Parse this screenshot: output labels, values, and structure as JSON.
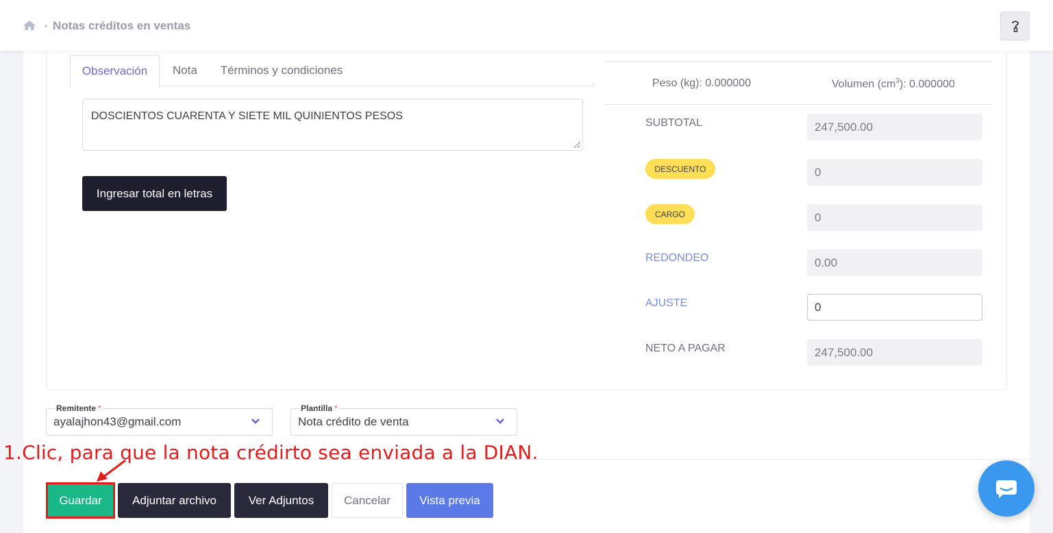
{
  "breadcrumb": {
    "home_icon": "home-icon",
    "title": "Notas créditos en ventas"
  },
  "header": {
    "help_icon": "question-key-icon"
  },
  "tabs": [
    {
      "label": "Observación",
      "active": true
    },
    {
      "label": "Nota",
      "active": false
    },
    {
      "label": "Términos y condiciones",
      "active": false
    }
  ],
  "observacion": {
    "text": "DOSCIENTOS CUARENTA Y SIETE MIL QUINIENTOS  PESOS",
    "button_label": "Ingresar total en letras"
  },
  "measures": {
    "peso": "Peso (kg): 0.000000",
    "volumen_prefix": "Volumen (cm",
    "volumen_sup": "3",
    "volumen_suffix": "): 0.000000"
  },
  "summary": {
    "subtotal": {
      "label": "SUBTOTAL",
      "value": "247,500.00"
    },
    "descuento": {
      "label": "DESCUENTO",
      "value": "0"
    },
    "cargo": {
      "label": "CARGO",
      "value": "0"
    },
    "redondeo": {
      "label": "REDONDEO",
      "value": "0.00"
    },
    "ajuste": {
      "label": "AJUSTE",
      "value": "0"
    },
    "neto": {
      "label": "NETO A PAGAR",
      "value": "247,500.00"
    }
  },
  "remitente": {
    "label": "Remitente",
    "required_mark": "*",
    "value": "ayalajhon43@gmail.com"
  },
  "plantilla": {
    "label": "Plantilla",
    "required_mark": "*",
    "value": "Nota crédito de venta"
  },
  "annotation": "1.Clic, para que la nota crédirto sea enviada a la DIAN.",
  "actions": {
    "save": "Guardar",
    "attach": "Adjuntar archivo",
    "view_attachments": "Ver Adjuntos",
    "cancel": "Cancelar",
    "preview": "Vista previa"
  },
  "colors": {
    "accent_tab": "#716aca",
    "badge_yellow": "#ffde57",
    "save_green": "#1ab789",
    "preview_blue": "#5b7ae8",
    "annotation_red": "#e41b1b",
    "chat_blue": "#3a98ef"
  }
}
